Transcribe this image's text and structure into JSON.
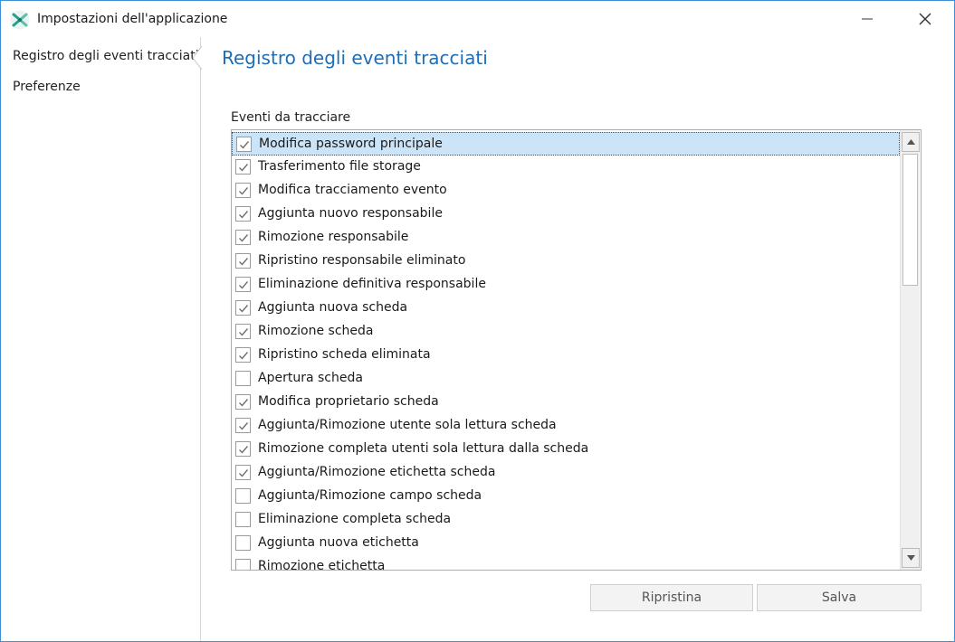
{
  "window": {
    "title": "Impostazioni dell'applicazione"
  },
  "sidebar": {
    "items": [
      {
        "label": "Registro degli eventi tracciati",
        "active": true
      },
      {
        "label": "Preferenze",
        "active": false
      }
    ]
  },
  "main": {
    "title": "Registro degli eventi tracciati",
    "group_label": "Eventi da tracciare",
    "events": [
      {
        "label": "Modifica password principale",
        "checked": true
      },
      {
        "label": "Trasferimento file storage",
        "checked": true
      },
      {
        "label": "Modifica tracciamento evento",
        "checked": true
      },
      {
        "label": "Aggiunta nuovo responsabile",
        "checked": true
      },
      {
        "label": "Rimozione responsabile",
        "checked": true
      },
      {
        "label": "Ripristino responsabile eliminato",
        "checked": true
      },
      {
        "label": "Eliminazione definitiva responsabile",
        "checked": true
      },
      {
        "label": "Aggiunta nuova scheda",
        "checked": true
      },
      {
        "label": "Rimozione scheda",
        "checked": true
      },
      {
        "label": "Ripristino scheda eliminata",
        "checked": true
      },
      {
        "label": "Apertura scheda",
        "checked": false
      },
      {
        "label": "Modifica proprietario scheda",
        "checked": true
      },
      {
        "label": "Aggiunta/Rimozione utente sola lettura scheda",
        "checked": true
      },
      {
        "label": "Rimozione completa utenti sola lettura dalla scheda",
        "checked": true
      },
      {
        "label": "Aggiunta/Rimozione etichetta scheda",
        "checked": true
      },
      {
        "label": "Aggiunta/Rimozione campo scheda",
        "checked": false
      },
      {
        "label": "Eliminazione completa scheda",
        "checked": false
      },
      {
        "label": "Aggiunta nuova etichetta",
        "checked": false
      },
      {
        "label": "Rimozione etichetta",
        "checked": false
      }
    ],
    "selected_index": 0
  },
  "buttons": {
    "reset_label": "Ripristina",
    "save_label": "Salva"
  },
  "colors": {
    "accent": "#1d6db7",
    "window_border": "#3d8fd6",
    "selection": "#cce4f7",
    "app_icon": "#2a9d8f"
  },
  "icons": {
    "app": "app-logo-icon",
    "minimize": "minimize-icon",
    "close": "close-icon",
    "check": "checkmark-icon",
    "scroll_up": "chevron-up-icon",
    "scroll_down": "chevron-down-icon"
  }
}
